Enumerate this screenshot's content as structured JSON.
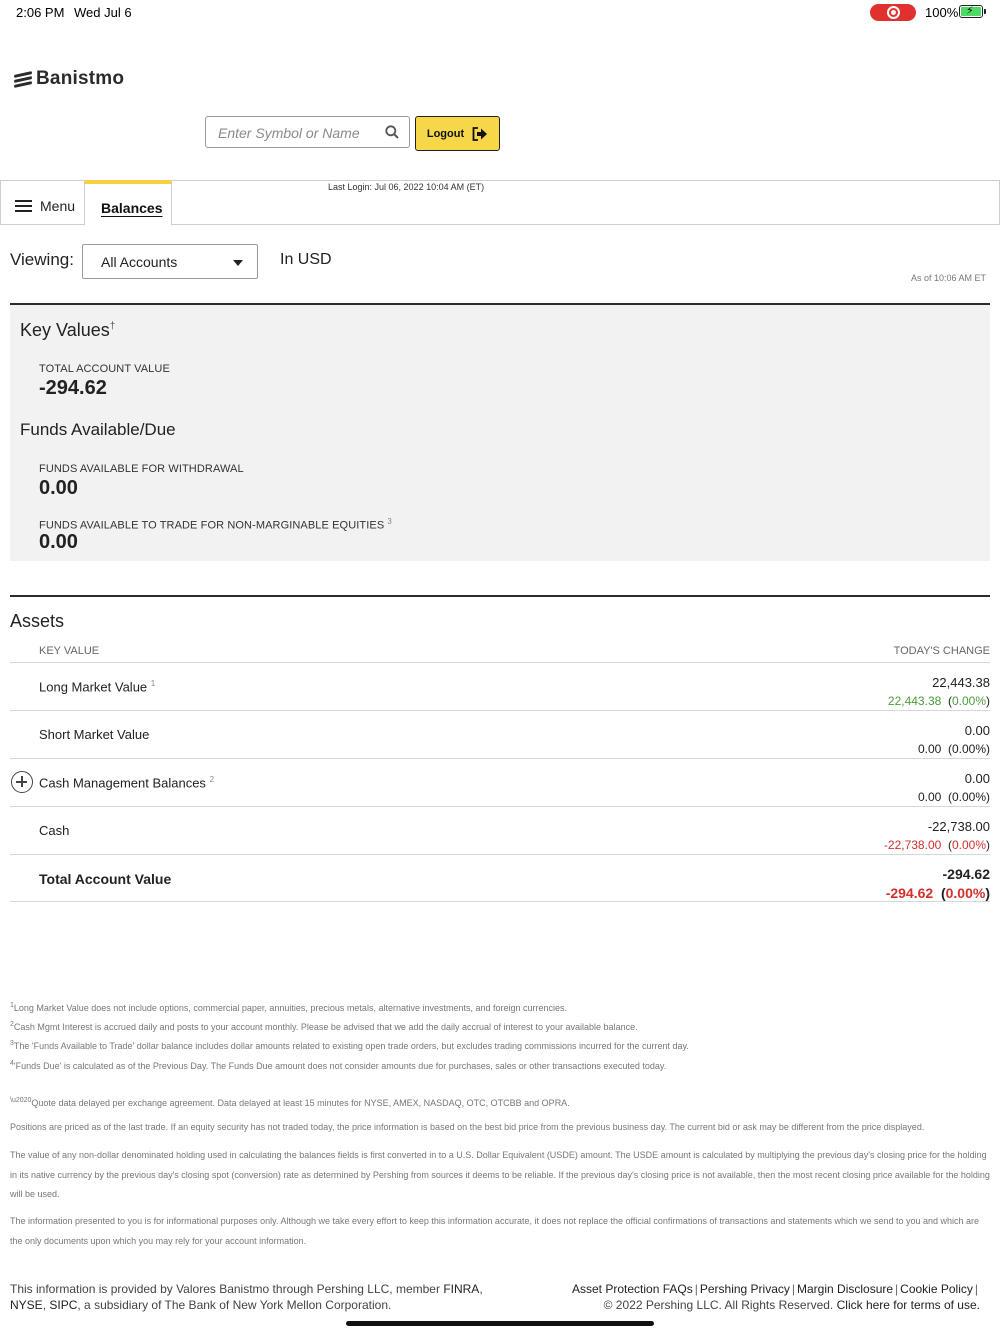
{
  "status_bar": {
    "time": "2:06 PM",
    "date": "Wed Jul 6",
    "battery": "100%",
    "record_color": "#e0312f"
  },
  "brand": {
    "name": "Banistmo"
  },
  "search": {
    "placeholder": "Enter Symbol or Name"
  },
  "logout": {
    "label": "Logout"
  },
  "nav": {
    "menu_label": "Menu",
    "active_tab": "Balances",
    "last_login": "Last Login: Jul 06, 2022 10:04 AM (ET)"
  },
  "viewing": {
    "label": "Viewing:",
    "selected": "All Accounts",
    "currency": "In USD",
    "as_of": "As of 10:06 AM ET"
  },
  "key_values": {
    "title": "Key Values",
    "dagger": "†",
    "total_label": "TOTAL ACCOUNT VALUE",
    "total_value": "-294.62",
    "funds_title": "Funds Available/Due",
    "withdrawal_label": "FUNDS AVAILABLE FOR WITHDRAWAL",
    "withdrawal_value": "0.00",
    "trade_label": "FUNDS AVAILABLE TO TRADE FOR NON-MARGINABLE EQUITIES",
    "trade_sup": "3",
    "trade_value": "0.00"
  },
  "assets": {
    "title": "Assets",
    "col_key": "KEY VALUE",
    "col_change": "TODAY'S CHANGE",
    "rows": [
      {
        "label": "Long Market Value",
        "sup": "1",
        "value": "22,443.38",
        "change": "22,443.38",
        "pct": "(0.00%)"
      },
      {
        "label": "Short Market Value",
        "sup": "",
        "value": "0.00",
        "change": "0.00",
        "pct": "(0.00%)"
      },
      {
        "label": "Cash Management Balances",
        "sup": "2",
        "value": "0.00",
        "change": "0.00",
        "pct": "(0.00%)"
      },
      {
        "label": "Cash",
        "sup": "",
        "value": "-22,738.00",
        "change": "-22,738.00",
        "pct": "(0.00%)"
      },
      {
        "label": "Total Account Value",
        "sup": "",
        "value": "-294.62",
        "change": "-294.62",
        "pct": "(0.00%)"
      }
    ],
    "colors": {
      "positive": "#4a9d3a",
      "negative": "#d2302b"
    }
  },
  "footnotes": {
    "f1_num": "1",
    "f1": "Long Market Value does not include options, commercial paper, annuities, precious metals, alternative investments, and foreign currencies.",
    "f2_num": "2",
    "f2": "Cash Mgmt Interest is accrued daily and posts to your account monthly. Please be advised that we add the daily accrual of interest to your available balance.",
    "f3_num": "3",
    "f3": "The 'Funds Available to Trade' dollar balance includes dollar amounts related to existing open trade orders, but excludes trading commissions incurred for the current day.",
    "f4_num": "4",
    "f4": "'Funds Due' is calculated as of the Previous Day. The Funds Due amount does not consider amounts due for purchases, sales or other transactions executed today.",
    "q_mark": "\\u2020",
    "quote": "Quote data delayed per exchange agreement. Data delayed at least 15 minutes for NYSE, AMEX, NASDAQ, OTC, OTCBB and OPRA.",
    "positions": "Positions are priced as of the last trade. If an equity security has not traded today, the price information is based on the best bid price from the previous business day. The current bid or ask may be different from the price displayed.",
    "usde": "The value of any non-dollar denominated holding used in calculating the balances fields is first converted in to a U.S. Dollar Equivalent (USDE) amount. The USDE amount is calculated by multiplying the previous day's closing price for the holding in its native currency by the previous day's closing spot (conversion) rate as determined by Pershing from sources it deems to be reliable. If the previous day's closing price is not available, then the most recent closing price available for the holding will be used.",
    "info": "The information presented to you is for informational purposes only. Although we take every effort to keep this information accurate, it does not replace the official confirmations of transactions and statements which we send to you and which are the only documents upon which you may rely for your account information."
  },
  "footer": {
    "left_1": "This information is provided by Valores Banistmo through Pershing LLC, member ",
    "finra": "FINRA",
    "comma": ",",
    "nyse": "NYSE",
    "sipc": "SIPC",
    "left_2": ", a subsidiary of The Bank of New York Mellon Corporation.",
    "links": [
      "Asset Protection FAQs",
      "Pershing Privacy",
      "Margin Disclosure",
      "Cookie Policy"
    ],
    "copyright": "© 2022 Pershing LLC. All Rights Reserved.",
    "terms": "Click here for terms of use."
  }
}
